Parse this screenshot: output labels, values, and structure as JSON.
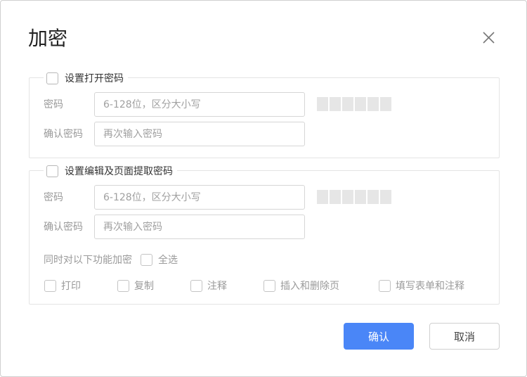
{
  "dialog": {
    "title": "加密",
    "close_icon": "close-icon"
  },
  "open_password": {
    "legend": "设置打开密码",
    "checked": false,
    "password_label": "密码",
    "password_placeholder": "6-128位，区分大小写",
    "confirm_label": "确认密码",
    "confirm_placeholder": "再次输入密码"
  },
  "edit_password": {
    "legend": "设置编辑及页面提取密码",
    "checked": false,
    "password_label": "密码",
    "password_placeholder": "6-128位，区分大小写",
    "confirm_label": "确认密码",
    "confirm_placeholder": "再次输入密码",
    "features_label": "同时对以下功能加密",
    "select_all_label": "全选",
    "options": [
      {
        "label": "打印",
        "checked": false
      },
      {
        "label": "复制",
        "checked": false
      },
      {
        "label": "注释",
        "checked": false
      },
      {
        "label": "插入和删除页",
        "checked": false
      },
      {
        "label": "填写表单和注释",
        "checked": false
      }
    ]
  },
  "buttons": {
    "confirm": "确认",
    "cancel": "取消"
  },
  "colors": {
    "primary": "#4a86f7",
    "strength_empty": "#e6e6e6"
  }
}
